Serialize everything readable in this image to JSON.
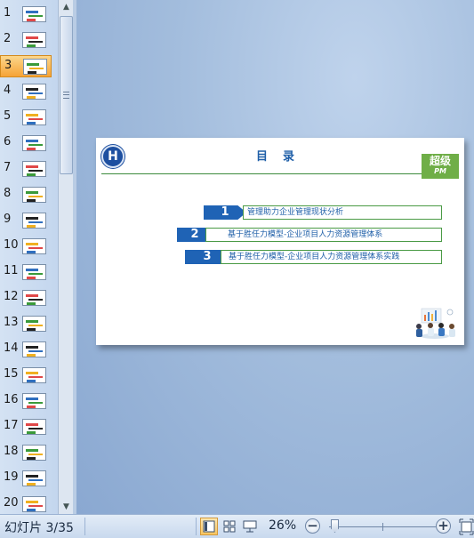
{
  "thumbnails": [
    {
      "number": "1"
    },
    {
      "number": "2"
    },
    {
      "number": "3",
      "selected": true
    },
    {
      "number": "4"
    },
    {
      "number": "5"
    },
    {
      "number": "6"
    },
    {
      "number": "7"
    },
    {
      "number": "8"
    },
    {
      "number": "9"
    },
    {
      "number": "10"
    },
    {
      "number": "11"
    },
    {
      "number": "12"
    },
    {
      "number": "13"
    },
    {
      "number": "14"
    },
    {
      "number": "15"
    },
    {
      "number": "16"
    },
    {
      "number": "17"
    },
    {
      "number": "18"
    },
    {
      "number": "19"
    },
    {
      "number": "20"
    }
  ],
  "slide": {
    "logo_text": "H",
    "title": "目　录",
    "brand_line1": "超级",
    "brand_line2": "PM",
    "toc": [
      {
        "num": "1",
        "text": "管理助力企业管理现状分析"
      },
      {
        "num": "2",
        "text": "基于胜任力模型-企业项目人力资源管理体系"
      },
      {
        "num": "3",
        "text": "基于胜任力模型-企业项目人力资源管理体系实践"
      }
    ]
  },
  "statusbar": {
    "slide_indicator": "幻灯片 3/35",
    "zoom": "26%",
    "zoom_out": "−",
    "zoom_in": "+"
  },
  "colors": {
    "accent_blue": "#1f63b5",
    "green_border": "#4a9a45",
    "brand_green": "#6fae47",
    "selected_thumb": "#f6a336"
  },
  "icons": {
    "normal_view": "normal-view-icon",
    "slide_sorter": "slide-sorter-icon",
    "slideshow": "slideshow-icon",
    "fit_window": "fit-window-icon"
  }
}
